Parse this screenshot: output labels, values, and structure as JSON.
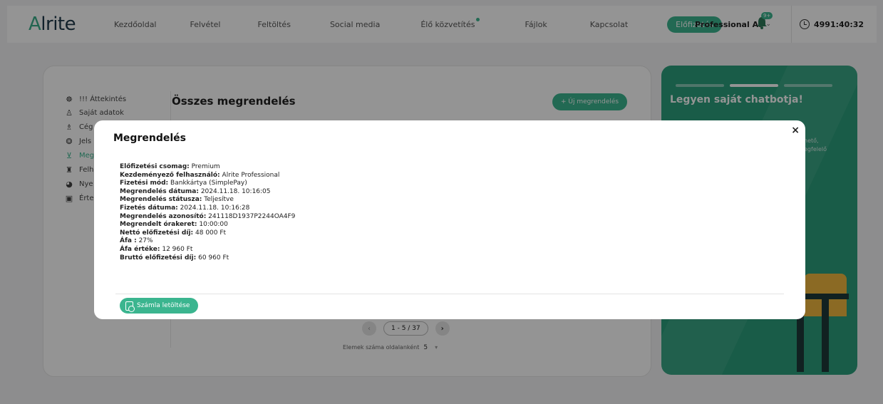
{
  "app": {
    "logo": "Alrite"
  },
  "nav": {
    "items": [
      "Kezdőoldal",
      "Felvétel",
      "Feltöltés",
      "Social media",
      "Élő közvetítés",
      "Fájlok",
      "Kapcsolat",
      "Előfizetés"
    ],
    "active": "Előfizetés"
  },
  "user": {
    "name": "Professional A.",
    "notifications": "9+"
  },
  "timer": {
    "value": "4991:40:32"
  },
  "sidebar": {
    "items": [
      {
        "label": "!!! Áttekintés",
        "icon": "overview-icon"
      },
      {
        "label": "Saját adatok",
        "icon": "user-icon"
      },
      {
        "label": "Cég",
        "icon": "company-icon"
      },
      {
        "label": "Jels",
        "icon": "password-icon"
      },
      {
        "label": "Meg",
        "icon": "cart-icon"
      },
      {
        "label": "Felh",
        "icon": "users-icon"
      },
      {
        "label": "Nye",
        "icon": "language-icon"
      },
      {
        "label": "Érte",
        "icon": "notification-icon"
      }
    ]
  },
  "main": {
    "title": "Összes megrendelés",
    "new_order_button": "+ Új megrendelés",
    "pagination": {
      "label": "1 - 5 / 37"
    },
    "per_page": {
      "label": "Elemek száma oldalanként",
      "value": "5"
    }
  },
  "promo": {
    "title": "Legyen saját chatbotja!",
    "sub_line1": "hető,",
    "sub_line2": "egfelelő"
  },
  "modal": {
    "title": "Megrendelés",
    "close": "×",
    "details": [
      {
        "label": "Előfizetési csomag:",
        "value": "Premium"
      },
      {
        "label": "Kezdeményező felhasználó:",
        "value": "Alrite Professional"
      },
      {
        "label": "Fizetési mód:",
        "value": "Bankkártya (SimplePay)"
      },
      {
        "label": "Megrendelés dátuma:",
        "value": "2024.11.18. 10:16:05"
      },
      {
        "label": "Megrendelés státusza:",
        "value": "Teljesítve"
      },
      {
        "label": "Fizetés dátuma:",
        "value": "2024.11.18. 10:16:28"
      },
      {
        "label": "Megrendelés azonosító:",
        "value": "241118D1937P2244OA4F9"
      },
      {
        "label": "Megrendelt órakeret:",
        "value": "10:00:00"
      },
      {
        "label": "Nettó előfizetési díj:",
        "value": "48 000 Ft"
      },
      {
        "label": "Áfa :",
        "value": "27%"
      },
      {
        "label": "Áfa értéke:",
        "value": "12 960 Ft"
      },
      {
        "label": "Bruttó előfizetési díj:",
        "value": "60 960 Ft"
      }
    ],
    "download_button": "Számla letöltése"
  },
  "colors": {
    "accent": "#3bb58f",
    "promo_bg": "#2c9f7c"
  }
}
